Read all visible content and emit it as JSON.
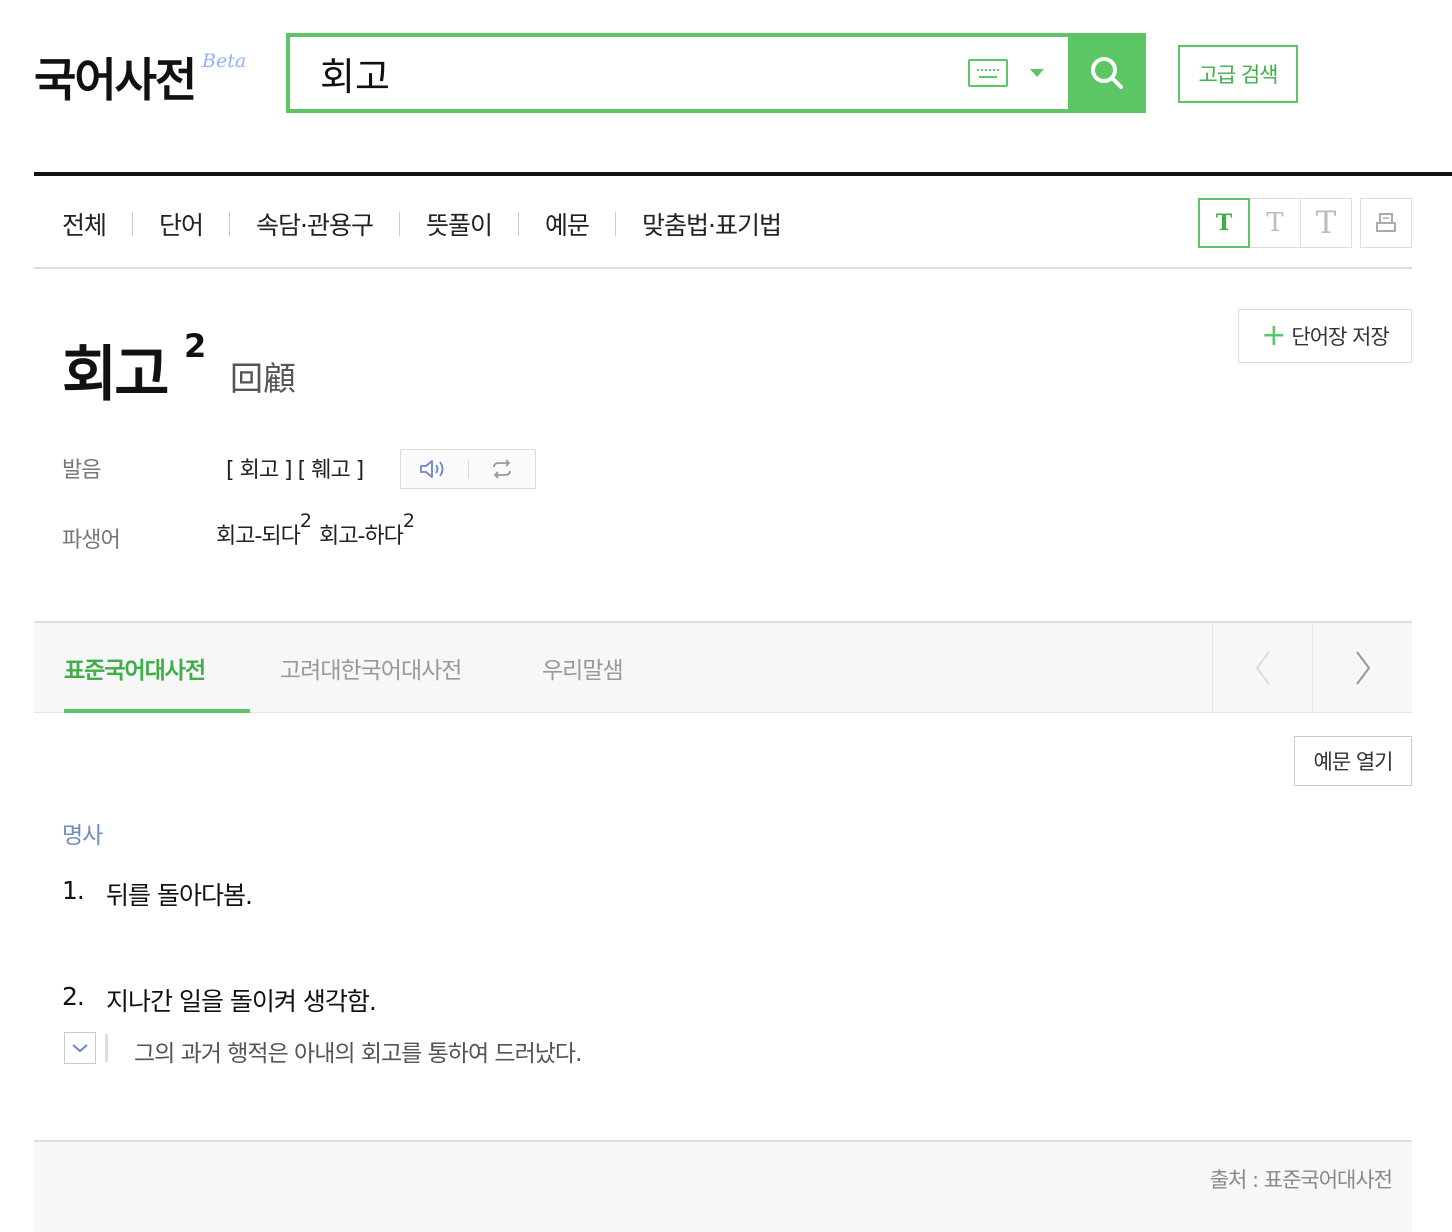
{
  "header": {
    "logo_text": "국어사전",
    "logo_badge": "Beta",
    "search_value": "회고",
    "advanced_search_label": "고급 검색"
  },
  "nav": {
    "categories": [
      "전체",
      "단어",
      "속담·관용구",
      "뜻풀이",
      "예문",
      "맞춤법·표기법"
    ],
    "font_size_labels": [
      "T",
      "T",
      "T"
    ]
  },
  "entry": {
    "word": "회고",
    "homograph_number": "2",
    "hanja": "回顧",
    "save_label": "단어장 저장",
    "pronunciation_label": "발음",
    "pronunciation": "[ 회고 ] [ 훼고 ]",
    "derivatives_label": "파생어",
    "derivatives": [
      {
        "word": "회고-되다",
        "sup": "2"
      },
      {
        "word": "회고-하다",
        "sup": "2"
      }
    ]
  },
  "dict_tabs": {
    "items": [
      "표준국어대사전",
      "고려대한국어대사전",
      "우리말샘"
    ],
    "active": 0
  },
  "definition": {
    "example_open_label": "예문 열기",
    "part_of_speech": "명사",
    "senses": [
      {
        "num": "1.",
        "text": "뒤를 돌아다봄."
      },
      {
        "num": "2.",
        "text": "지나간 일을 돌이켜 생각함."
      }
    ],
    "example": "그의 과거 행적은 아내의 회고를 통하여 드러났다."
  },
  "footer": {
    "source": "출처 : 표준국어대사전"
  },
  "colors": {
    "accent_green": "#5cc665",
    "pos_blue": "#6e8fbc"
  }
}
